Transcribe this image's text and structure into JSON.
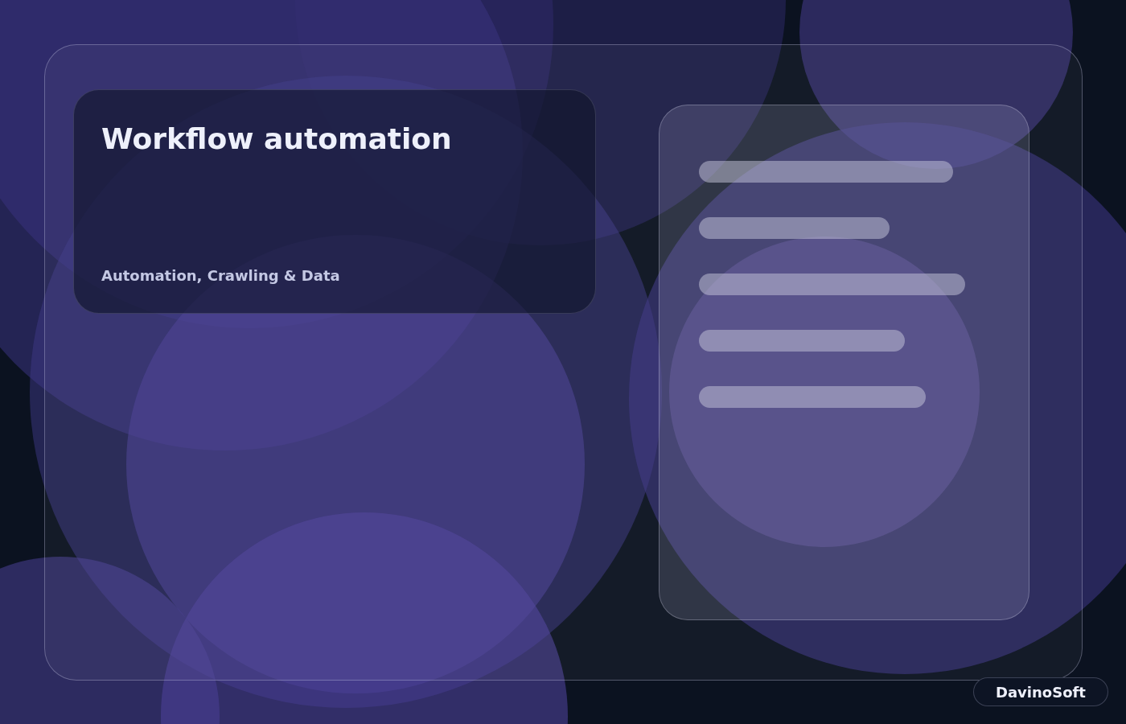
{
  "title_card": {
    "title": "Workflow automation",
    "subtitle": "Automation, Crawling & Data"
  },
  "brand_badge": {
    "label": "DavinoSoft"
  }
}
